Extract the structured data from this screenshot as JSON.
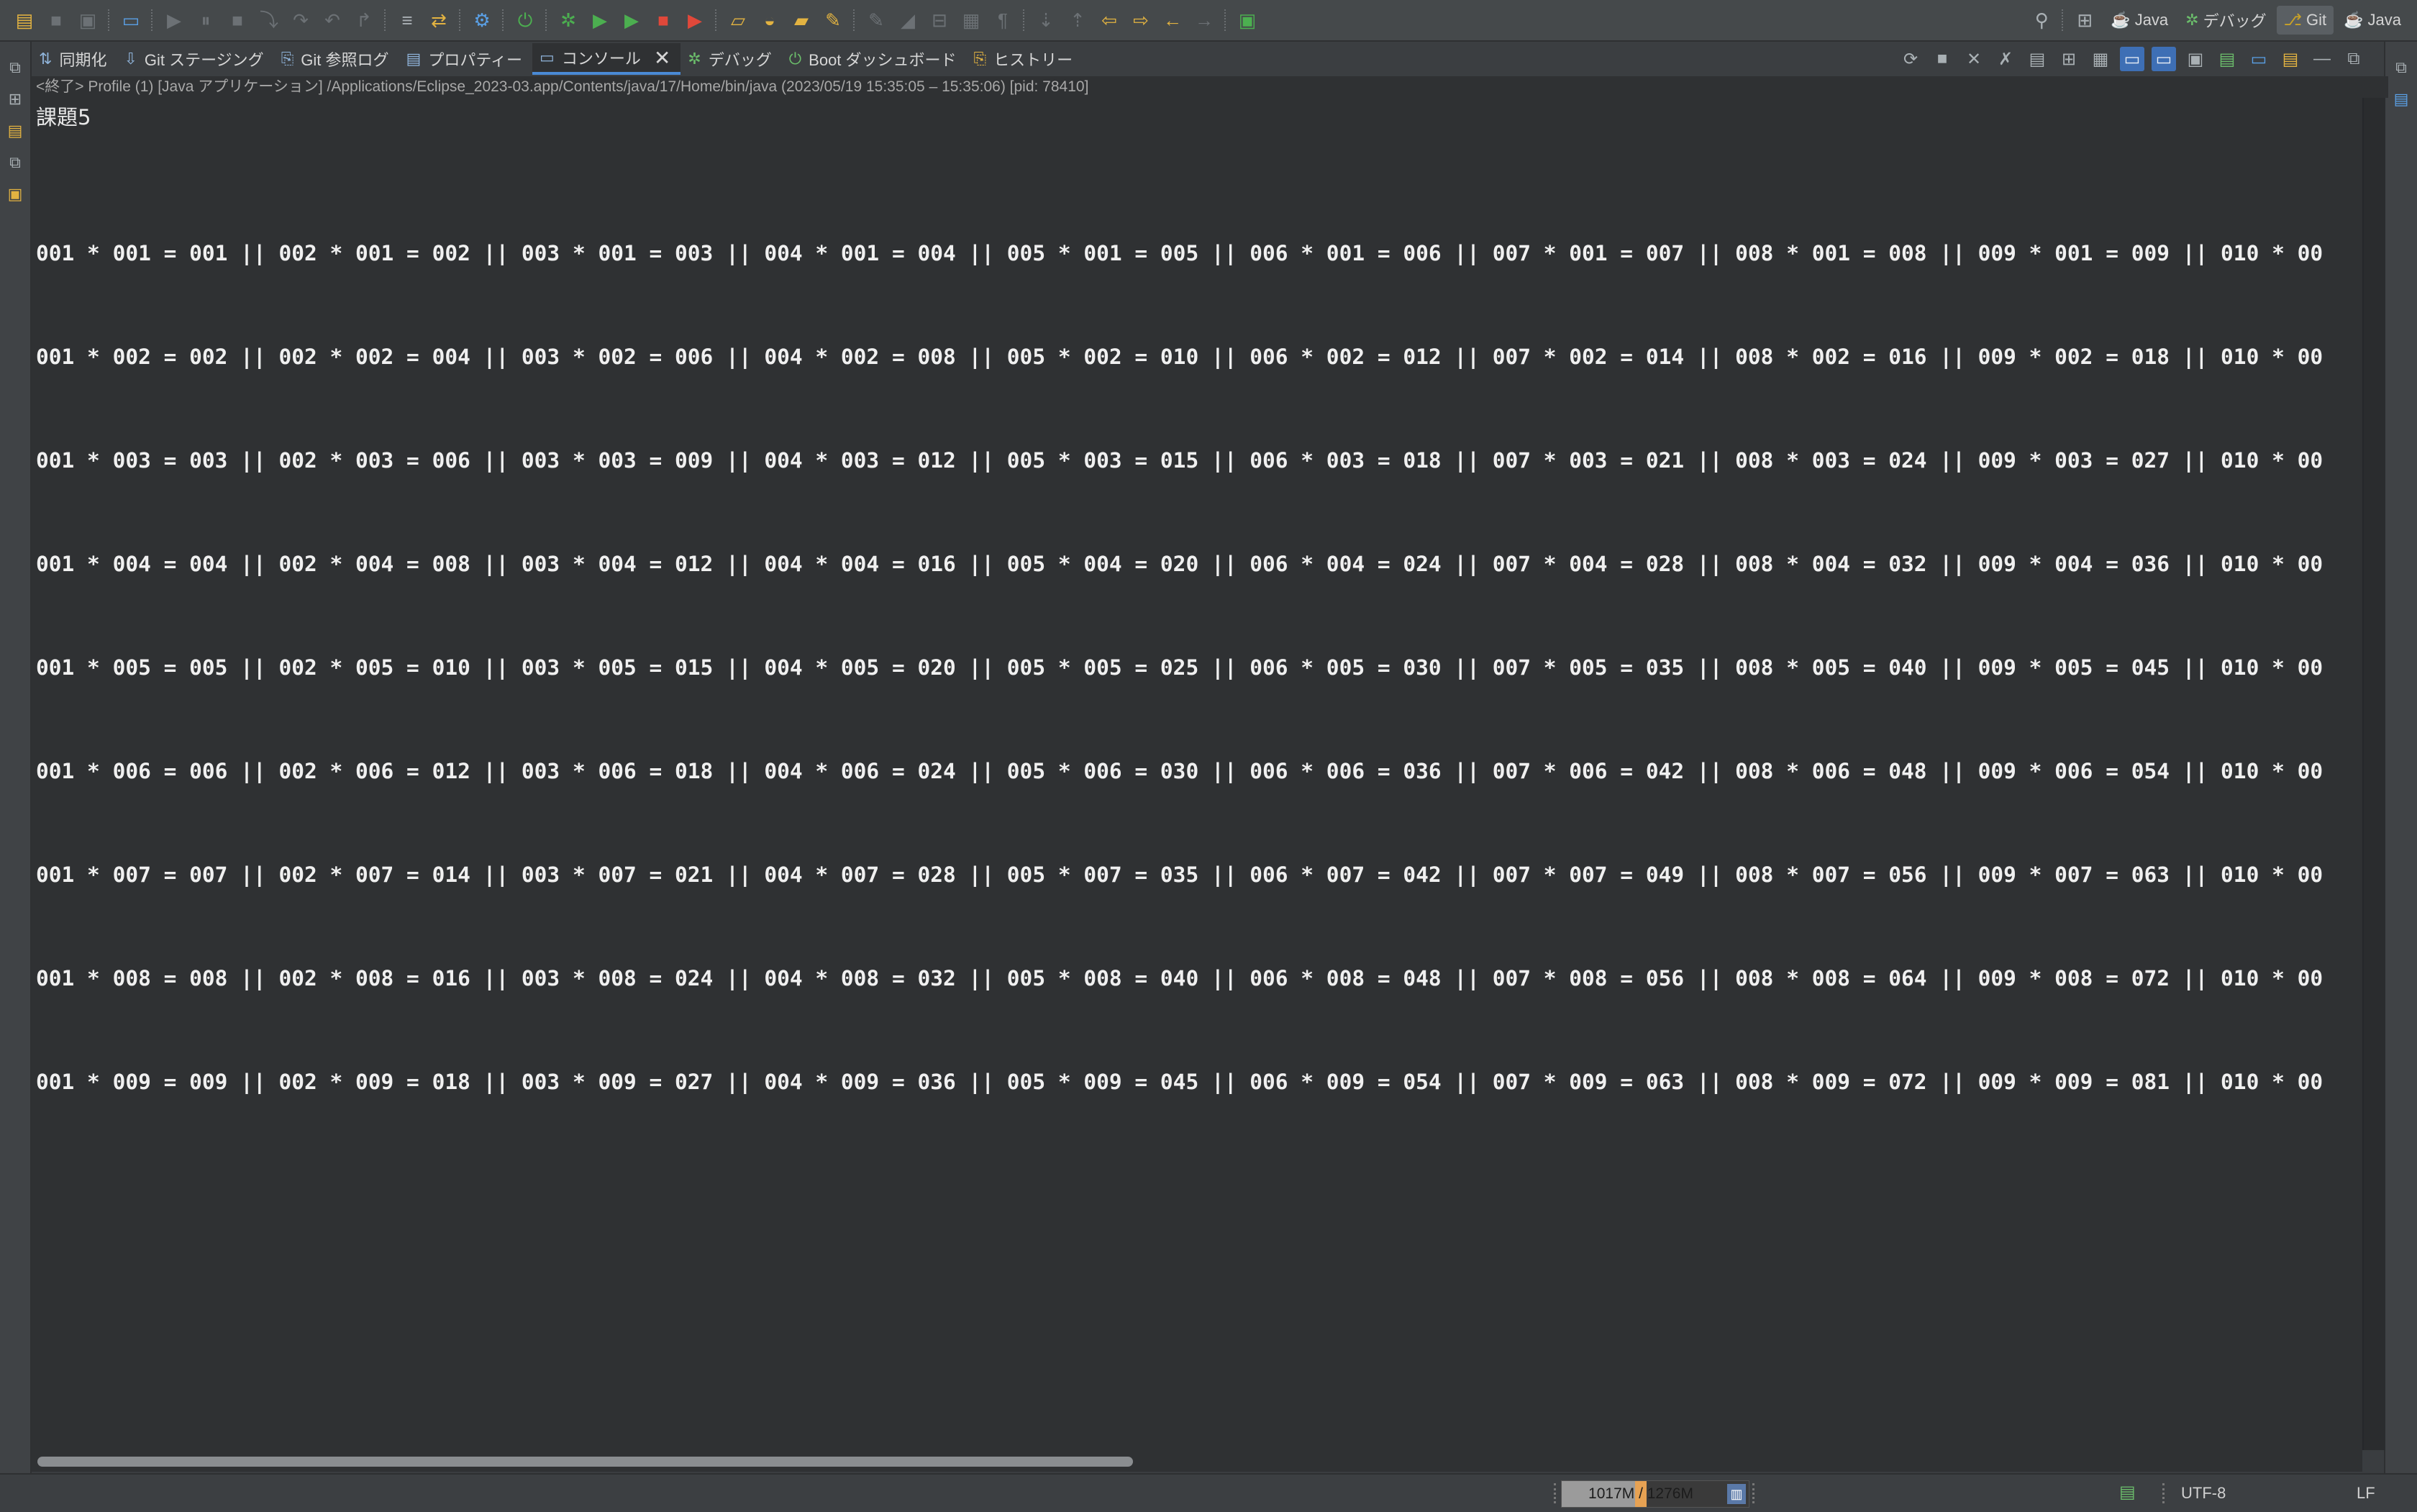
{
  "toolbar": {
    "icons": [
      "new-icon",
      "save-icon",
      "save-all-icon",
      "console-icon",
      "resume-icon",
      "suspend-icon",
      "terminate-icon",
      "step-into-icon",
      "step-over-icon",
      "step-return-icon",
      "drop-to-frame-icon",
      "use-step-filters-icon",
      "open-type-icon",
      "settings-icon",
      "boot-icon",
      "debug-icon",
      "run-icon",
      "coverage-icon",
      "stop-icon",
      "external-tools-icon",
      "open-folder-icon",
      "open-file-icon",
      "open-task-icon",
      "search-icon",
      "annotation-icon",
      "pen-icon",
      "toggle-icon",
      "block-icon",
      "pilcrow-icon",
      "next-annotation-icon",
      "prev-annotation-icon",
      "back-icon",
      "forward-icon",
      "pin-icon"
    ],
    "perspectives": [
      {
        "label": "Java",
        "icon": "java-perspective-icon"
      },
      {
        "label": "デバッグ",
        "icon": "debug-perspective-icon"
      },
      {
        "label": "Git",
        "icon": "git-perspective-icon",
        "active": true
      },
      {
        "label": "Java",
        "icon": "java-perspective-icon"
      }
    ]
  },
  "tabs": [
    {
      "label": "同期化",
      "icon": "sync-icon"
    },
    {
      "label": "Git ステージング",
      "icon": "git-staging-icon"
    },
    {
      "label": "Git 参照ログ",
      "icon": "git-reflog-icon"
    },
    {
      "label": "プロパティー",
      "icon": "properties-icon"
    },
    {
      "label": "コンソール",
      "icon": "console-icon",
      "active": true
    },
    {
      "label": "デバッグ",
      "icon": "debug-icon"
    },
    {
      "label": "Boot ダッシュボード",
      "icon": "boot-dashboard-icon"
    },
    {
      "label": "ヒストリー",
      "icon": "history-icon"
    }
  ],
  "console": {
    "header": "<終了> Profile (1) [Java アプリケーション] /Applications/Eclipse_2023-03.app/Contents/java/17/Home/bin/java  (2023/05/19 15:35:05 – 15:35:06) [pid: 78410]",
    "title": "課題5",
    "lines": [
      "001 * 001 = 001 || 002 * 001 = 002 || 003 * 001 = 003 || 004 * 001 = 004 || 005 * 001 = 005 || 006 * 001 = 006 || 007 * 001 = 007 || 008 * 001 = 008 || 009 * 001 = 009 || 010 * 00",
      "001 * 002 = 002 || 002 * 002 = 004 || 003 * 002 = 006 || 004 * 002 = 008 || 005 * 002 = 010 || 006 * 002 = 012 || 007 * 002 = 014 || 008 * 002 = 016 || 009 * 002 = 018 || 010 * 00",
      "001 * 003 = 003 || 002 * 003 = 006 || 003 * 003 = 009 || 004 * 003 = 012 || 005 * 003 = 015 || 006 * 003 = 018 || 007 * 003 = 021 || 008 * 003 = 024 || 009 * 003 = 027 || 010 * 00",
      "001 * 004 = 004 || 002 * 004 = 008 || 003 * 004 = 012 || 004 * 004 = 016 || 005 * 004 = 020 || 006 * 004 = 024 || 007 * 004 = 028 || 008 * 004 = 032 || 009 * 004 = 036 || 010 * 00",
      "001 * 005 = 005 || 002 * 005 = 010 || 003 * 005 = 015 || 004 * 005 = 020 || 005 * 005 = 025 || 006 * 005 = 030 || 007 * 005 = 035 || 008 * 005 = 040 || 009 * 005 = 045 || 010 * 00",
      "001 * 006 = 006 || 002 * 006 = 012 || 003 * 006 = 018 || 004 * 006 = 024 || 005 * 006 = 030 || 006 * 006 = 036 || 007 * 006 = 042 || 008 * 006 = 048 || 009 * 006 = 054 || 010 * 00",
      "001 * 007 = 007 || 002 * 007 = 014 || 003 * 007 = 021 || 004 * 007 = 028 || 005 * 007 = 035 || 006 * 007 = 042 || 007 * 007 = 049 || 008 * 007 = 056 || 009 * 007 = 063 || 010 * 00",
      "001 * 008 = 008 || 002 * 008 = 016 || 003 * 008 = 024 || 004 * 008 = 032 || 005 * 008 = 040 || 006 * 008 = 048 || 007 * 008 = 056 || 008 * 008 = 064 || 009 * 008 = 072 || 010 * 00",
      "001 * 009 = 009 || 002 * 009 = 018 || 003 * 009 = 027 || 004 * 009 = 036 || 005 * 009 = 045 || 006 * 009 = 054 || 007 * 009 = 063 || 008 * 009 = 072 || 009 * 009 = 081 || 010 * 00"
    ],
    "hscroll_fraction": 0.47
  },
  "status": {
    "heap_label": "1017M / 1276M",
    "heap_used_fraction": 0.45,
    "heap_committed_fraction": 0.53,
    "encoding": "UTF-8",
    "line_delimiter": "LF"
  }
}
